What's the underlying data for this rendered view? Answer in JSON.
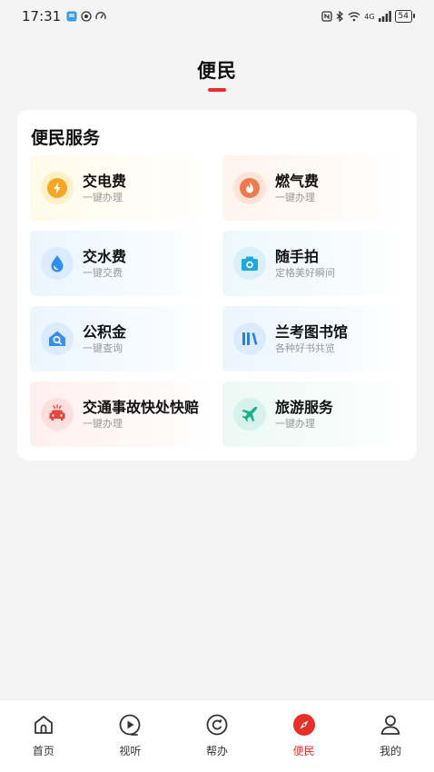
{
  "status_bar": {
    "time": "17:31",
    "network": "4G",
    "battery": "54"
  },
  "page": {
    "title": "便民"
  },
  "services": {
    "section_title": "便民服务",
    "items": [
      {
        "title": "交电费",
        "subtitle": "一键办理",
        "icon": "lightning-icon",
        "color": "#f5a623"
      },
      {
        "title": "燃气费",
        "subtitle": "一键办理",
        "icon": "flame-icon",
        "color": "#f07a4f"
      },
      {
        "title": "交水费",
        "subtitle": "一键交费",
        "icon": "water-drop-icon",
        "color": "#2f8ff0"
      },
      {
        "title": "随手拍",
        "subtitle": "定格美好瞬间",
        "icon": "camera-icon",
        "color": "#1ea8e0"
      },
      {
        "title": "公积金",
        "subtitle": "一键查询",
        "icon": "house-search-icon",
        "color": "#3a8ef0"
      },
      {
        "title": "兰考图书馆",
        "subtitle": "各种好书共览",
        "icon": "books-icon",
        "color": "#2b7fd6"
      },
      {
        "title": "交通事故快处快赔",
        "subtitle": "一键办理",
        "icon": "car-accident-icon",
        "color": "#e8463c"
      },
      {
        "title": "旅游服务",
        "subtitle": "一键办理",
        "icon": "airplane-icon",
        "color": "#1fae8a"
      }
    ]
  },
  "bottom_nav": {
    "active": "便民",
    "accent_color": "#e8302a",
    "items": [
      {
        "label": "首页",
        "icon": "home-icon"
      },
      {
        "label": "视听",
        "icon": "play-icon"
      },
      {
        "label": "帮办",
        "icon": "help-icon"
      },
      {
        "label": "便民",
        "icon": "compass-icon"
      },
      {
        "label": "我的",
        "icon": "user-icon"
      }
    ]
  }
}
